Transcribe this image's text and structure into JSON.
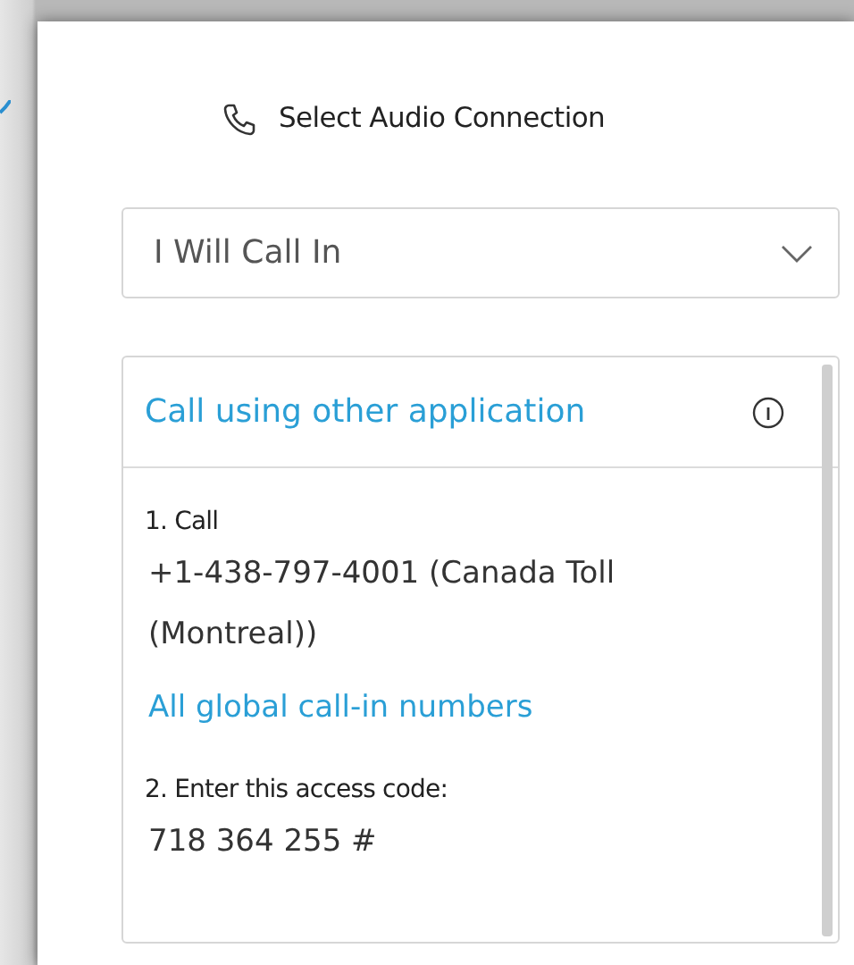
{
  "dialog": {
    "title": "Select Audio Connection"
  },
  "audio_option": {
    "value": "I Will Call In"
  },
  "panel": {
    "header": "Call using other application",
    "steps": [
      {
        "kind": "heading",
        "text": "1. Call"
      },
      {
        "kind": "value",
        "text": "+1-438-797-4001 (Canada Toll (Montreal))"
      },
      {
        "kind": "link",
        "text": "All global call-in numbers"
      },
      {
        "kind": "heading",
        "text": "2. Enter this access code:"
      },
      {
        "kind": "value",
        "text": "718 364 255 #"
      }
    ]
  }
}
